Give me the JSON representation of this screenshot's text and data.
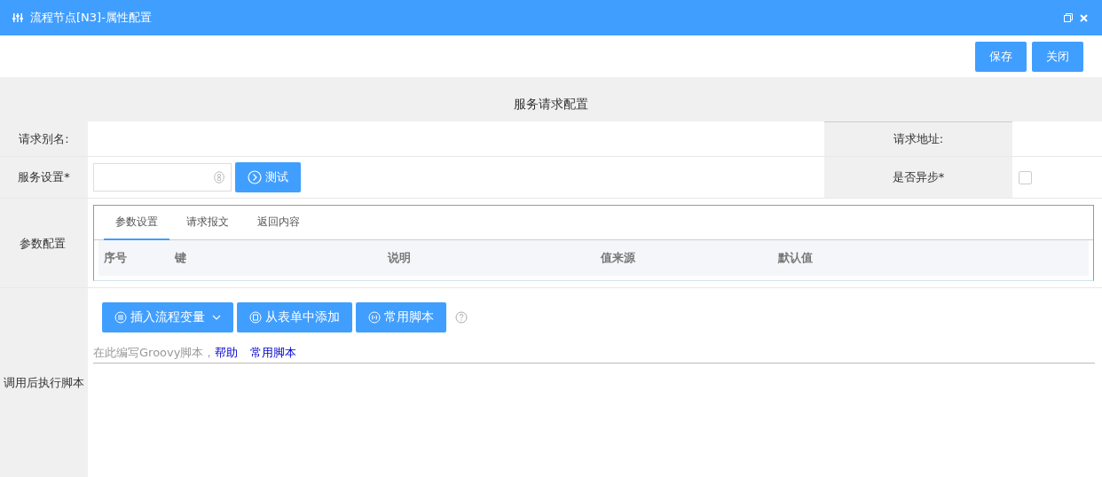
{
  "window": {
    "title": "流程节点[N3]-属性配置"
  },
  "toolbar": {
    "buttons": [
      "保存",
      "关闭"
    ]
  },
  "section": {
    "title": "服务请求配置"
  },
  "fields": {
    "alias": {
      "label": "请求别名:"
    },
    "address": {
      "label": "请求地址:"
    },
    "service": {
      "label": "服务设置*",
      "button": "测试"
    },
    "async": {
      "label": "是否异步*",
      "checked": false
    }
  },
  "params": {
    "label": "参数配置",
    "tabs": [
      {
        "label": "参数设置",
        "selected": true
      },
      {
        "label": "请求报文",
        "selected": false
      },
      {
        "label": "返回内容",
        "selected": false
      }
    ],
    "columns": [
      "序号",
      "键",
      "说明",
      "值来源",
      "默认值"
    ]
  },
  "script": {
    "label": "调用后执行脚本",
    "buttons": [
      {
        "label": "插入流程变量",
        "dropdown": true
      },
      {
        "label": "从表单中添加",
        "dropdown": false
      },
      {
        "label": "常用脚本",
        "dropdown": false
      }
    ],
    "hint": "在此编写Groovy脚本，",
    "links": [
      "帮助",
      "常用脚本"
    ]
  }
}
